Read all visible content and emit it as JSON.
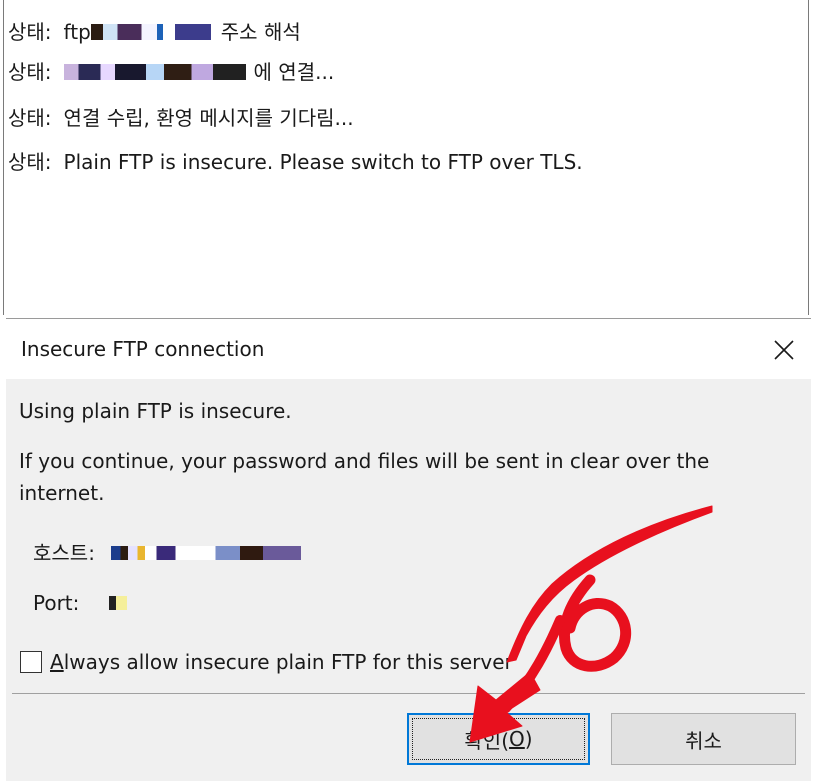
{
  "log": {
    "lines": [
      {
        "prefix": "상태:",
        "text_before": "ftp",
        "text_after": "주소 해석"
      },
      {
        "prefix": "상태:",
        "text_before": "",
        "text_after": "에 연결..."
      },
      {
        "prefix": "상태:",
        "text_before": "",
        "text_after": "연결 수립, 환영 메시지를 기다림..."
      },
      {
        "prefix": "상태:",
        "text_before": "",
        "text_after": "Plain FTP is insecure. Please switch to FTP over TLS."
      }
    ]
  },
  "dialog": {
    "title": "Insecure FTP connection",
    "message1": "Using plain FTP is insecure.",
    "message2_line1": "If you continue, your password and files will be sent in clear over the",
    "message2_line2": "internet.",
    "host_label": "호스트:",
    "port_label": "Port:",
    "checkbox_label_accel": "A",
    "checkbox_label_rest": "lways allow insecure plain FTP for this server",
    "checkbox_checked": false,
    "ok_label_main": "확인(",
    "ok_label_accel": "O",
    "ok_label_end": ")",
    "cancel_label": "취소"
  },
  "colors": {
    "annotation": "#e8101e",
    "focus_border": "#0078d7"
  },
  "icons": {
    "close": "close-icon",
    "annotation": "hand-drawn-arrow-annotation"
  }
}
